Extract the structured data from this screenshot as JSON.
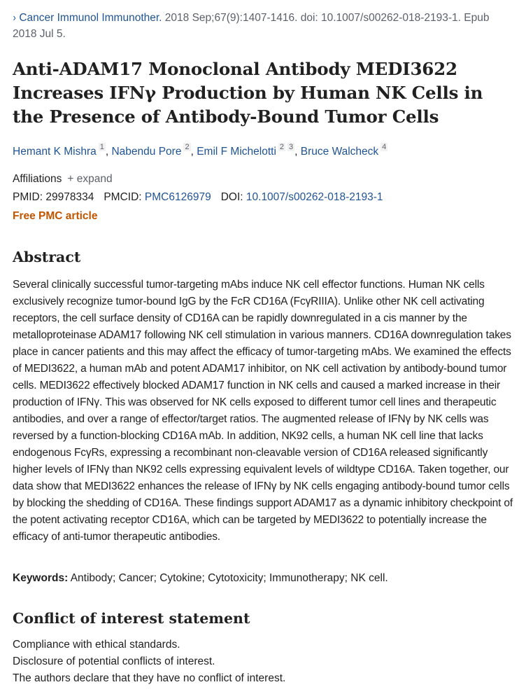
{
  "citation": {
    "chevron": "›",
    "journal": "Cancer Immunol Immunother.",
    "details": " 2018 Sep;67(9):1407-1416. doi: 10.1007/s00262-018-2193-1. Epub 2018 Jul 5."
  },
  "title": "Anti-ADAM17 Monoclonal Antibody MEDI3622 Increases IFNγ Production by Human NK Cells in the Presence of Antibody-Bound Tumor Cells",
  "authors": [
    {
      "name": "Hemant K Mishra",
      "affs": "1"
    },
    {
      "name": "Nabendu Pore",
      "affs": "2"
    },
    {
      "name": "Emil F Michelotti",
      "affs": "2",
      "affs2": "3"
    },
    {
      "name": "Bruce Walcheck",
      "affs": "4"
    }
  ],
  "affiliations": {
    "label": "Affiliations",
    "expand": "+ expand"
  },
  "ids": {
    "pmid_label": "PMID:",
    "pmid": "29978334",
    "pmcid_label": "PMCID:",
    "pmcid": "PMC6126979",
    "doi_label": "DOI:",
    "doi": "10.1007/s00262-018-2193-1"
  },
  "free_pmc": "Free PMC article",
  "abstract": {
    "heading": "Abstract",
    "text": "Several clinically successful tumor-targeting mAbs induce NK cell effector functions. Human NK cells exclusively recognize tumor-bound IgG by the FcR CD16A (FcγRIIIA). Unlike other NK cell activating receptors, the cell surface density of CD16A can be rapidly downregulated in a cis manner by the metalloproteinase ADAM17 following NK cell stimulation in various manners. CD16A downregulation takes place in cancer patients and this may affect the efficacy of tumor-targeting mAbs. We examined the effects of MEDI3622, a human mAb and potent ADAM17 inhibitor, on NK cell activation by antibody-bound tumor cells. MEDI3622 effectively blocked ADAM17 function in NK cells and caused a marked increase in their production of IFNγ. This was observed for NK cells exposed to different tumor cell lines and therapeutic antibodies, and over a range of effector/target ratios. The augmented release of IFNγ by NK cells was reversed by a function-blocking CD16A mAb. In addition, NK92 cells, a human NK cell line that lacks endogenous FcγRs, expressing a recombinant non-cleavable version of CD16A released significantly higher levels of IFNγ than NK92 cells expressing equivalent levels of wildtype CD16A. Taken together, our data show that MEDI3622 enhances the release of IFNγ by NK cells engaging antibody-bound tumor cells by blocking the shedding of CD16A. These findings support ADAM17 as a dynamic inhibitory checkpoint of the potent activating receptor CD16A, which can be targeted by MEDI3622 to potentially increase the efficacy of anti-tumor therapeutic antibodies."
  },
  "keywords": {
    "label": "Keywords:",
    "text": " Antibody; Cancer; Cytokine; Cytotoxicity; Immunotherapy; NK cell."
  },
  "conflict": {
    "heading": "Conflict of interest statement",
    "lines": [
      "Compliance with ethical standards.",
      "Disclosure of potential conflicts of interest.",
      "The authors declare that they have no conflict of interest."
    ]
  },
  "colors": {
    "link": "#205493",
    "free_pmc": "#c05600",
    "text": "#212121",
    "muted": "#5b616b"
  }
}
